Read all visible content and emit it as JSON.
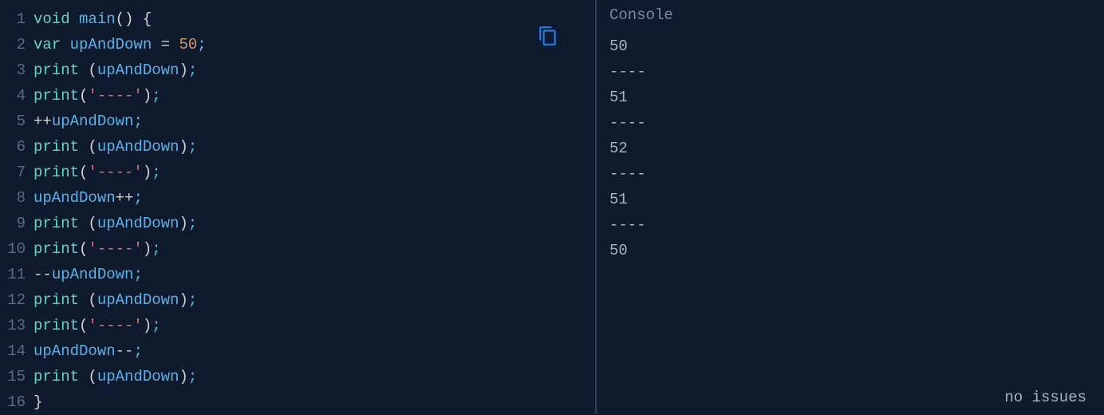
{
  "editor": {
    "lines": [
      {
        "num": "1",
        "tokens": [
          {
            "t": "void ",
            "c": "tok-keyword"
          },
          {
            "t": "main",
            "c": "tok-func"
          },
          {
            "t": "()",
            "c": "tok-paren"
          },
          {
            "t": " {",
            "c": "tok-brace"
          }
        ]
      },
      {
        "num": "2",
        "tokens": [
          {
            "t": "var ",
            "c": "tok-keyword"
          },
          {
            "t": "upAndDown",
            "c": "tok-var"
          },
          {
            "t": " = ",
            "c": "tok-eq"
          },
          {
            "t": "50",
            "c": "tok-num"
          },
          {
            "t": ";",
            "c": "tok-punc"
          }
        ]
      },
      {
        "num": "3",
        "tokens": [
          {
            "t": "print ",
            "c": "tok-call"
          },
          {
            "t": "(",
            "c": "tok-paren"
          },
          {
            "t": "upAndDown",
            "c": "tok-var"
          },
          {
            "t": ")",
            "c": "tok-paren"
          },
          {
            "t": ";",
            "c": "tok-punc"
          }
        ]
      },
      {
        "num": "4",
        "tokens": [
          {
            "t": "print",
            "c": "tok-call"
          },
          {
            "t": "(",
            "c": "tok-paren"
          },
          {
            "t": "'----'",
            "c": "tok-str"
          },
          {
            "t": ")",
            "c": "tok-paren"
          },
          {
            "t": ";",
            "c": "tok-punc"
          }
        ]
      },
      {
        "num": "5",
        "tokens": [
          {
            "t": "++",
            "c": "tok-op"
          },
          {
            "t": "upAndDown",
            "c": "tok-var"
          },
          {
            "t": ";",
            "c": "tok-punc"
          }
        ]
      },
      {
        "num": "6",
        "tokens": [
          {
            "t": "print ",
            "c": "tok-call"
          },
          {
            "t": "(",
            "c": "tok-paren"
          },
          {
            "t": "upAndDown",
            "c": "tok-var"
          },
          {
            "t": ")",
            "c": "tok-paren"
          },
          {
            "t": ";",
            "c": "tok-punc"
          }
        ]
      },
      {
        "num": "7",
        "tokens": [
          {
            "t": "print",
            "c": "tok-call"
          },
          {
            "t": "(",
            "c": "tok-paren"
          },
          {
            "t": "'----'",
            "c": "tok-str"
          },
          {
            "t": ")",
            "c": "tok-paren"
          },
          {
            "t": ";",
            "c": "tok-punc"
          }
        ]
      },
      {
        "num": "8",
        "tokens": [
          {
            "t": "upAndDown",
            "c": "tok-var"
          },
          {
            "t": "++",
            "c": "tok-op"
          },
          {
            "t": ";",
            "c": "tok-punc"
          }
        ]
      },
      {
        "num": "9",
        "tokens": [
          {
            "t": "print ",
            "c": "tok-call"
          },
          {
            "t": "(",
            "c": "tok-paren"
          },
          {
            "t": "upAndDown",
            "c": "tok-var"
          },
          {
            "t": ")",
            "c": "tok-paren"
          },
          {
            "t": ";",
            "c": "tok-punc"
          }
        ]
      },
      {
        "num": "10",
        "tokens": [
          {
            "t": "print",
            "c": "tok-call"
          },
          {
            "t": "(",
            "c": "tok-paren"
          },
          {
            "t": "'----'",
            "c": "tok-str"
          },
          {
            "t": ")",
            "c": "tok-paren"
          },
          {
            "t": ";",
            "c": "tok-punc"
          }
        ]
      },
      {
        "num": "11",
        "tokens": [
          {
            "t": "--",
            "c": "tok-op"
          },
          {
            "t": "upAndDown",
            "c": "tok-var"
          },
          {
            "t": ";",
            "c": "tok-punc"
          }
        ]
      },
      {
        "num": "12",
        "tokens": [
          {
            "t": "print ",
            "c": "tok-call"
          },
          {
            "t": "(",
            "c": "tok-paren"
          },
          {
            "t": "upAndDown",
            "c": "tok-var"
          },
          {
            "t": ")",
            "c": "tok-paren"
          },
          {
            "t": ";",
            "c": "tok-punc"
          }
        ]
      },
      {
        "num": "13",
        "tokens": [
          {
            "t": "print",
            "c": "tok-call"
          },
          {
            "t": "(",
            "c": "tok-paren"
          },
          {
            "t": "'----'",
            "c": "tok-str"
          },
          {
            "t": ")",
            "c": "tok-paren"
          },
          {
            "t": ";",
            "c": "tok-punc"
          }
        ]
      },
      {
        "num": "14",
        "tokens": [
          {
            "t": "upAndDown",
            "c": "tok-var"
          },
          {
            "t": "--",
            "c": "tok-op"
          },
          {
            "t": ";",
            "c": "tok-punc"
          }
        ]
      },
      {
        "num": "15",
        "tokens": [
          {
            "t": "print ",
            "c": "tok-call"
          },
          {
            "t": "(",
            "c": "tok-paren"
          },
          {
            "t": "upAndDown",
            "c": "tok-var"
          },
          {
            "t": ")",
            "c": "tok-paren"
          },
          {
            "t": ";",
            "c": "tok-punc"
          }
        ]
      },
      {
        "num": "16",
        "tokens": [
          {
            "t": "}",
            "c": "tok-brace"
          }
        ]
      }
    ]
  },
  "console": {
    "title": "Console",
    "output": [
      "50",
      "----",
      "51",
      "----",
      "52",
      "----",
      "51",
      "----",
      "50"
    ],
    "status": "no issues"
  }
}
